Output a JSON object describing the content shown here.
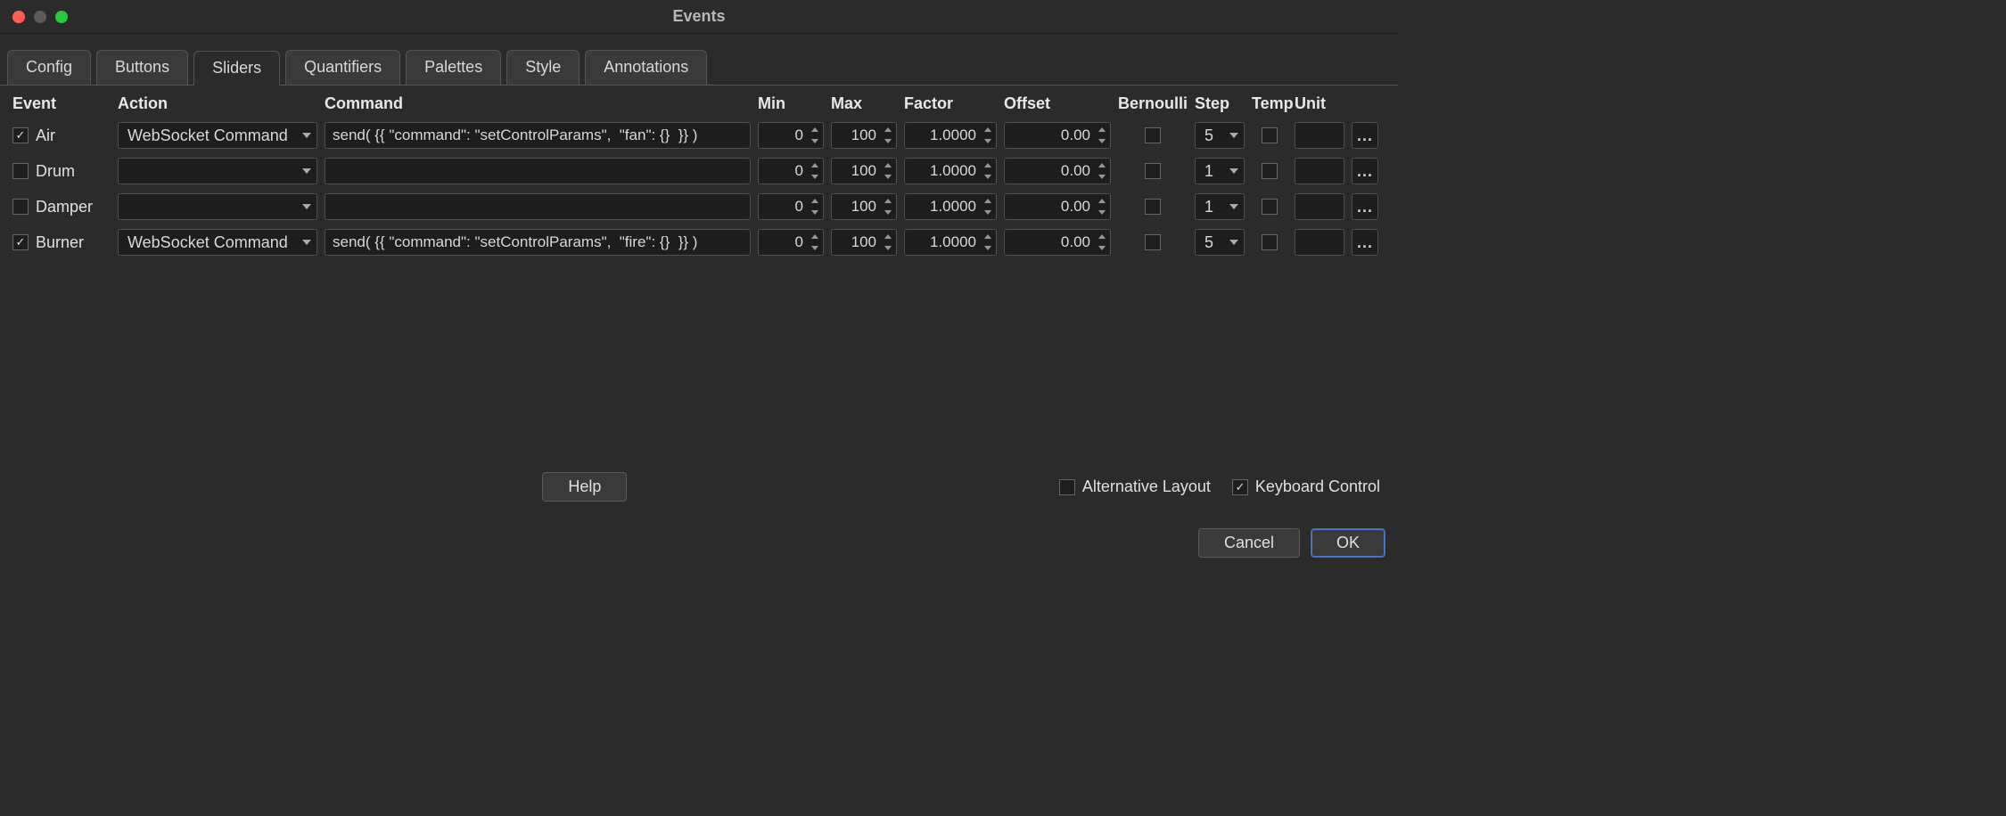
{
  "window": {
    "title": "Events"
  },
  "tabs": [
    {
      "label": "Config"
    },
    {
      "label": "Buttons"
    },
    {
      "label": "Sliders",
      "active": true
    },
    {
      "label": "Quantifiers"
    },
    {
      "label": "Palettes"
    },
    {
      "label": "Style"
    },
    {
      "label": "Annotations"
    }
  ],
  "headers": {
    "event": "Event",
    "action": "Action",
    "command": "Command",
    "min": "Min",
    "max": "Max",
    "factor": "Factor",
    "offset": "Offset",
    "bernoulli": "Bernoulli",
    "step": "Step",
    "temp": "Temp",
    "unit": "Unit"
  },
  "rows": [
    {
      "enabled": true,
      "event": "Air",
      "action": "WebSocket Command",
      "command": "send( {{ \"command\": \"setControlParams\",  \"fan\": {}  }} )",
      "min": "0",
      "max": "100",
      "factor": "1.0000",
      "offset": "0.00",
      "bernoulli": false,
      "step": "5",
      "temp": false,
      "unit": ""
    },
    {
      "enabled": false,
      "event": "Drum",
      "action": "",
      "command": "",
      "min": "0",
      "max": "100",
      "factor": "1.0000",
      "offset": "0.00",
      "bernoulli": false,
      "step": "1",
      "temp": false,
      "unit": ""
    },
    {
      "enabled": false,
      "event": "Damper",
      "action": "",
      "command": "",
      "min": "0",
      "max": "100",
      "factor": "1.0000",
      "offset": "0.00",
      "bernoulli": false,
      "step": "1",
      "temp": false,
      "unit": ""
    },
    {
      "enabled": true,
      "event": "Burner",
      "action": "WebSocket Command",
      "command": "send( {{ \"command\": \"setControlParams\",  \"fire\": {}  }} )",
      "min": "0",
      "max": "100",
      "factor": "1.0000",
      "offset": "0.00",
      "bernoulli": false,
      "step": "5",
      "temp": false,
      "unit": ""
    }
  ],
  "footer": {
    "help": "Help",
    "alt_layout_label": "Alternative Layout",
    "alt_layout_checked": false,
    "kb_control_label": "Keyboard Control",
    "kb_control_checked": true
  },
  "buttons": {
    "cancel": "Cancel",
    "ok": "OK"
  },
  "more_glyph": "..."
}
